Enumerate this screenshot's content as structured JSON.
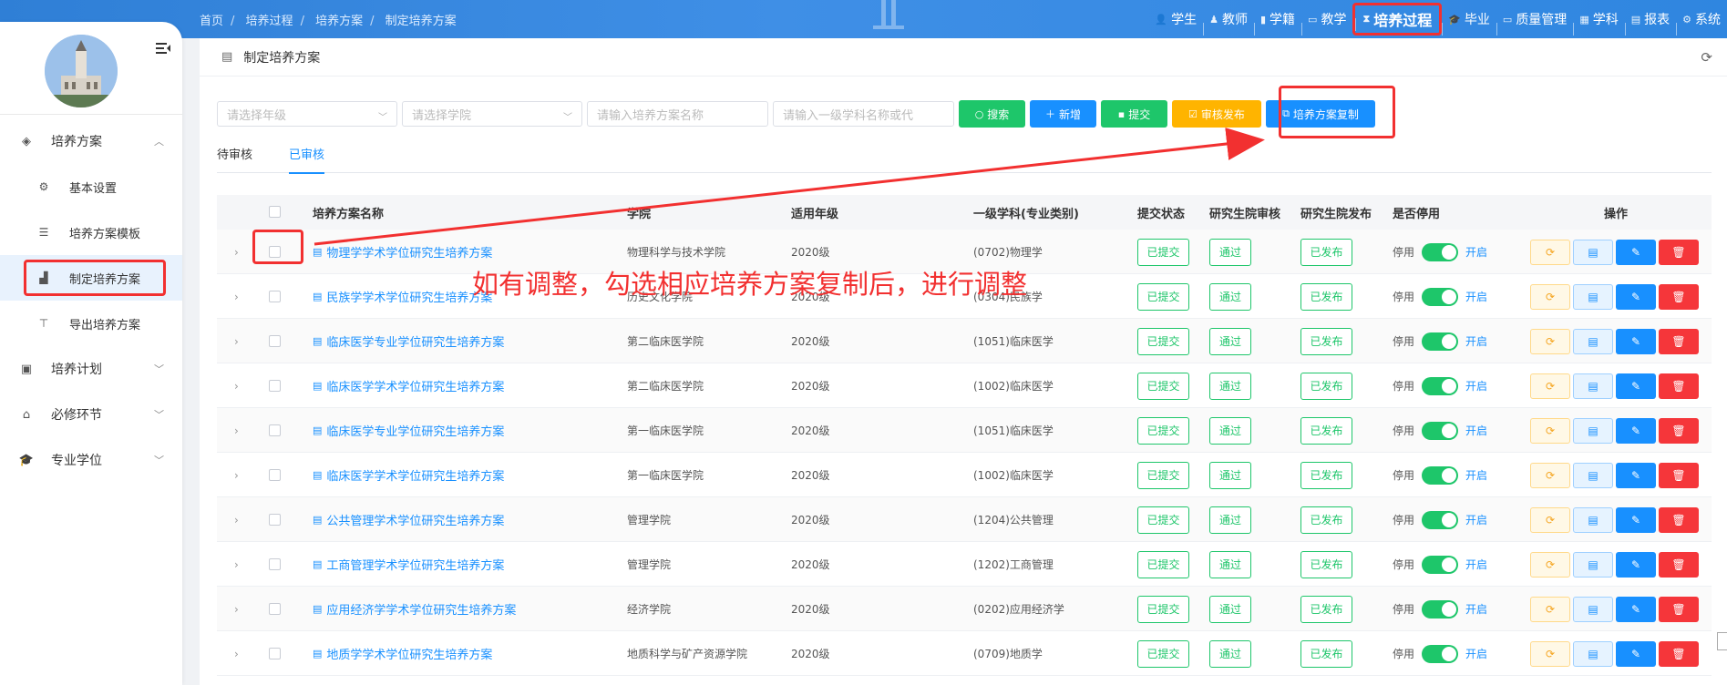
{
  "breadcrumb": [
    "首页",
    "培养过程",
    "培养方案",
    "制定培养方案"
  ],
  "top_nav": [
    {
      "label": "学生",
      "icon": "user-icon"
    },
    {
      "label": "教师",
      "icon": "teacher-icon"
    },
    {
      "label": "学籍",
      "icon": "book-icon"
    },
    {
      "label": "教学",
      "icon": "monitor-icon"
    },
    {
      "label": "培养过程",
      "icon": "hourglass-icon",
      "active": true
    },
    {
      "label": "毕业",
      "icon": "graduation-cap-icon"
    },
    {
      "label": "质量管理",
      "icon": "monitor-icon"
    },
    {
      "label": "学科",
      "icon": "grid-icon"
    },
    {
      "label": "报表",
      "icon": "table-icon"
    },
    {
      "label": "系统",
      "icon": "gear-icon"
    }
  ],
  "sidebar": {
    "menu": [
      {
        "label": "培养方案",
        "icon": "layers-icon",
        "expanded": true,
        "children": [
          {
            "label": "基本设置",
            "icon": "settings-icon"
          },
          {
            "label": "培养方案模板",
            "icon": "list-icon"
          },
          {
            "label": "制定培养方案",
            "icon": "chart-icon",
            "active": true
          },
          {
            "label": "导出培养方案",
            "icon": "paint-roller-icon"
          }
        ]
      },
      {
        "label": "培养计划",
        "icon": "calendar-icon"
      },
      {
        "label": "必修环节",
        "icon": "flow-icon"
      },
      {
        "label": "专业学位",
        "icon": "graduation-cap-icon"
      }
    ]
  },
  "card": {
    "title": "制定培养方案"
  },
  "filters": {
    "grade_placeholder": "请选择年级",
    "college_placeholder": "请选择学院",
    "name_placeholder": "请输入培养方案名称",
    "subject_placeholder": "请输入一级学科名称或代"
  },
  "buttons": {
    "search": "搜索",
    "add": "新增",
    "submit": "提交",
    "review_publish": "审核发布",
    "copy": "培养方案复制"
  },
  "tabs": [
    {
      "label": "待审核",
      "active": false
    },
    {
      "label": "已审核",
      "active": true
    }
  ],
  "table": {
    "headers": {
      "name": "培养方案名称",
      "college": "学院",
      "grade": "适用年级",
      "subject": "一级学科(专业类别)",
      "submit_status": "提交状态",
      "grad_review": "研究生院审核",
      "grad_publish": "研究生院发布",
      "disabled": "是否停用",
      "ops": "操作"
    },
    "switch_off_label": "停用",
    "switch_on_label": "开启",
    "rows": [
      {
        "name": "物理学学术学位研究生培养方案",
        "college": "物理科学与技术学院",
        "grade": "2020级",
        "subject": "(0702)物理学",
        "submit": "已提交",
        "review": "通过",
        "publish": "已发布"
      },
      {
        "name": "民族学学术学位研究生培养方案",
        "college": "历史文化学院",
        "grade": "2020级",
        "subject": "(0304)民族学",
        "submit": "已提交",
        "review": "通过",
        "publish": "已发布"
      },
      {
        "name": "临床医学专业学位研究生培养方案",
        "college": "第二临床医学院",
        "grade": "2020级",
        "subject": "(1051)临床医学",
        "submit": "已提交",
        "review": "通过",
        "publish": "已发布"
      },
      {
        "name": "临床医学学术学位研究生培养方案",
        "college": "第二临床医学院",
        "grade": "2020级",
        "subject": "(1002)临床医学",
        "submit": "已提交",
        "review": "通过",
        "publish": "已发布"
      },
      {
        "name": "临床医学专业学位研究生培养方案",
        "college": "第一临床医学院",
        "grade": "2020级",
        "subject": "(1051)临床医学",
        "submit": "已提交",
        "review": "通过",
        "publish": "已发布"
      },
      {
        "name": "临床医学学术学位研究生培养方案",
        "college": "第一临床医学院",
        "grade": "2020级",
        "subject": "(1002)临床医学",
        "submit": "已提交",
        "review": "通过",
        "publish": "已发布"
      },
      {
        "name": "公共管理学术学位研究生培养方案",
        "college": "管理学院",
        "grade": "2020级",
        "subject": "(1204)公共管理",
        "submit": "已提交",
        "review": "通过",
        "publish": "已发布"
      },
      {
        "name": "工商管理学术学位研究生培养方案",
        "college": "管理学院",
        "grade": "2020级",
        "subject": "(1202)工商管理",
        "submit": "已提交",
        "review": "通过",
        "publish": "已发布"
      },
      {
        "name": "应用经济学学术学位研究生培养方案",
        "college": "经济学院",
        "grade": "2020级",
        "subject": "(0202)应用经济学",
        "submit": "已提交",
        "review": "通过",
        "publish": "已发布"
      },
      {
        "name": "地质学学术学位研究生培养方案",
        "college": "地质科学与矿产资源学院",
        "grade": "2020级",
        "subject": "(0709)地质学",
        "submit": "已提交",
        "review": "通过",
        "publish": "已发布"
      }
    ]
  },
  "annotation": "如有调整，勾选相应培养方案复制后，进行调整",
  "colors": {
    "primary": "#1890ff",
    "success": "#1ec66a",
    "warning": "#ffb400",
    "danger": "#f5363a",
    "annotation": "#f23030"
  }
}
